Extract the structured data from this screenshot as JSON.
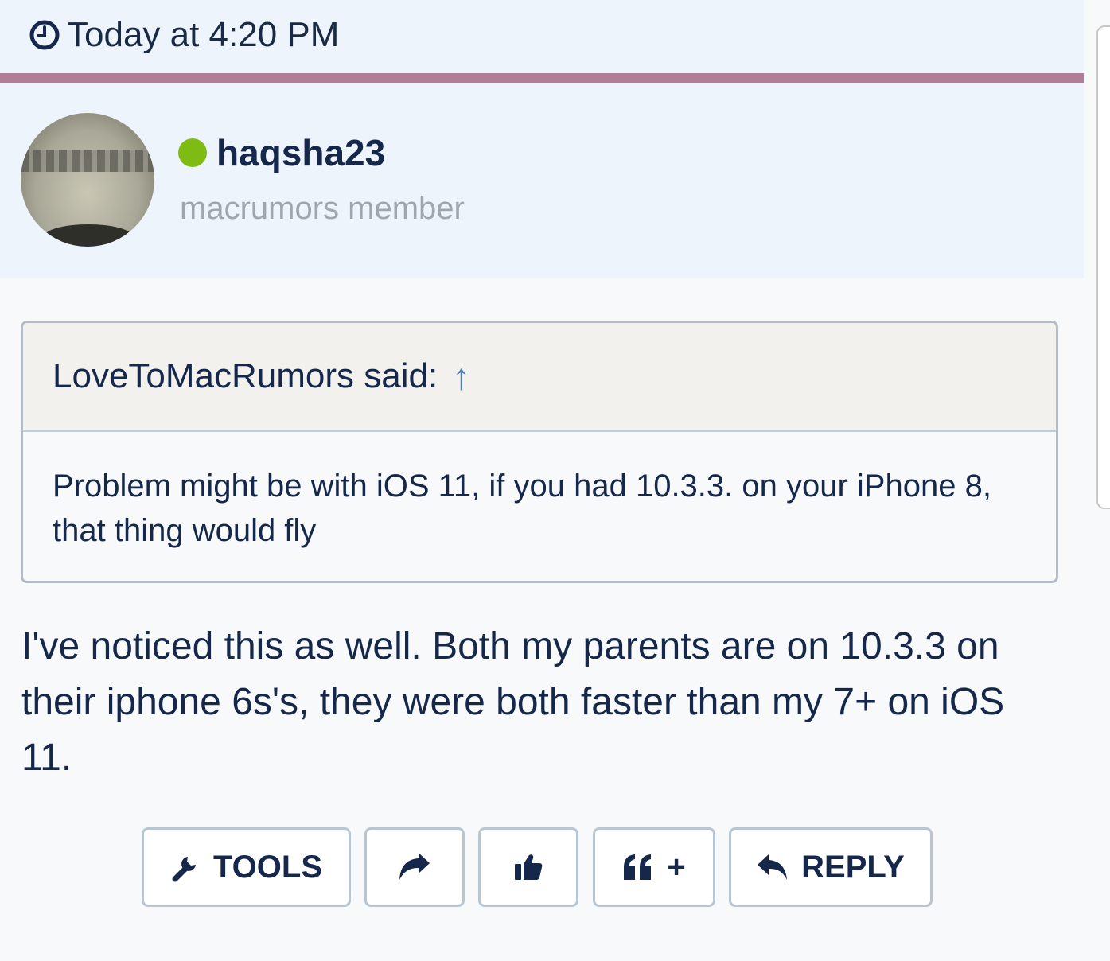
{
  "header": {
    "timestamp": "Today at 4:20 PM"
  },
  "user": {
    "name": "haqsha23",
    "title": "macrumors member",
    "status": "online"
  },
  "quote": {
    "author_line": "LoveToMacRumors said:",
    "arrow": "↑",
    "text": "Problem might be with iOS 11, if you had 10.3.3. on your iPhone 8, that thing would fly"
  },
  "post": {
    "text": "I've noticed this as well. Both my parents are on 10.3.3 on their iphone 6s's, they were both faster than my 7+ on iOS 11."
  },
  "actions": {
    "tools_label": "TOOLS",
    "multiquote_label": "+",
    "reply_label": "REPLY"
  },
  "icons": [
    "clock-icon",
    "wrench-icon",
    "share-icon",
    "thumbs-up-icon",
    "quote-icon",
    "reply-icon"
  ],
  "colors": {
    "accent_line": "#b27d97",
    "online": "#7ebc14",
    "text_primary": "#15284b",
    "text_muted": "#a1a6ad",
    "link": "#4d7ec2"
  }
}
